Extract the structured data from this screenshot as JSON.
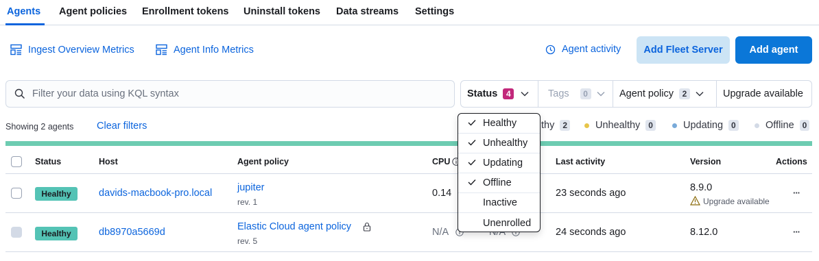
{
  "tabs": [
    {
      "label": "Agents",
      "active": true
    },
    {
      "label": "Agent policies"
    },
    {
      "label": "Enrollment tokens"
    },
    {
      "label": "Uninstall tokens"
    },
    {
      "label": "Data streams"
    },
    {
      "label": "Settings"
    }
  ],
  "actions": {
    "ingest_metrics": "Ingest Overview Metrics",
    "agent_metrics": "Agent Info Metrics",
    "agent_activity": "Agent activity",
    "add_fleet_server": "Add Fleet Server",
    "add_agent": "Add agent"
  },
  "search": {
    "placeholder": "Filter your data using KQL syntax",
    "value": ""
  },
  "filters": {
    "status": {
      "label": "Status",
      "count": "4"
    },
    "tags": {
      "label": "Tags",
      "count": "0"
    },
    "agent_policy": {
      "label": "Agent policy",
      "count": "2"
    },
    "upgrade": {
      "label": "Upgrade available"
    }
  },
  "summary": {
    "showing": "Showing 2 agents",
    "clear_filters": "Clear filters",
    "legend": [
      {
        "label": "Healthy",
        "visible_text": "thy",
        "count": "2",
        "color": "#54c3b5"
      },
      {
        "label": "Unhealthy",
        "count": "0",
        "color": "#e7c54a"
      },
      {
        "label": "Updating",
        "count": "0",
        "color": "#79aad9"
      },
      {
        "label": "Offline",
        "count": "0",
        "color": "#d3dae6"
      }
    ]
  },
  "colors": {
    "accent": "#0b64dd",
    "primary_button": "#0b77d8",
    "healthy": "#54c3b5",
    "status_count": "#c2287b",
    "health_bar": "#6dccb1"
  },
  "table": {
    "headers": {
      "status": "Status",
      "host": "Host",
      "policy": "Agent policy",
      "cpu": "CPU",
      "last_activity": "Last activity",
      "version": "Version",
      "actions": "Actions"
    },
    "rows": [
      {
        "status": "Healthy",
        "host": "davids-macbook-pro.local",
        "policy": "jupiter",
        "rev": "rev. 1",
        "cpu": "0.14",
        "last_activity": "23 seconds ago",
        "version": "8.9.0",
        "upgrade_note": "Upgrade available"
      },
      {
        "status": "Healthy",
        "host": "db8970a5669d",
        "policy": "Elastic Cloud agent policy",
        "rev": "rev. 5",
        "cpu": "N/A",
        "memory": "N/A",
        "last_activity": "24 seconds ago",
        "version": "8.12.0"
      }
    ]
  },
  "status_dropdown": {
    "options": [
      {
        "label": "Healthy",
        "checked": true
      },
      {
        "label": "Unhealthy",
        "checked": true
      },
      {
        "label": "Updating",
        "checked": true
      },
      {
        "label": "Offline",
        "checked": true
      },
      {
        "label": "Inactive",
        "checked": false
      },
      {
        "label": "Unenrolled",
        "checked": false
      }
    ]
  }
}
